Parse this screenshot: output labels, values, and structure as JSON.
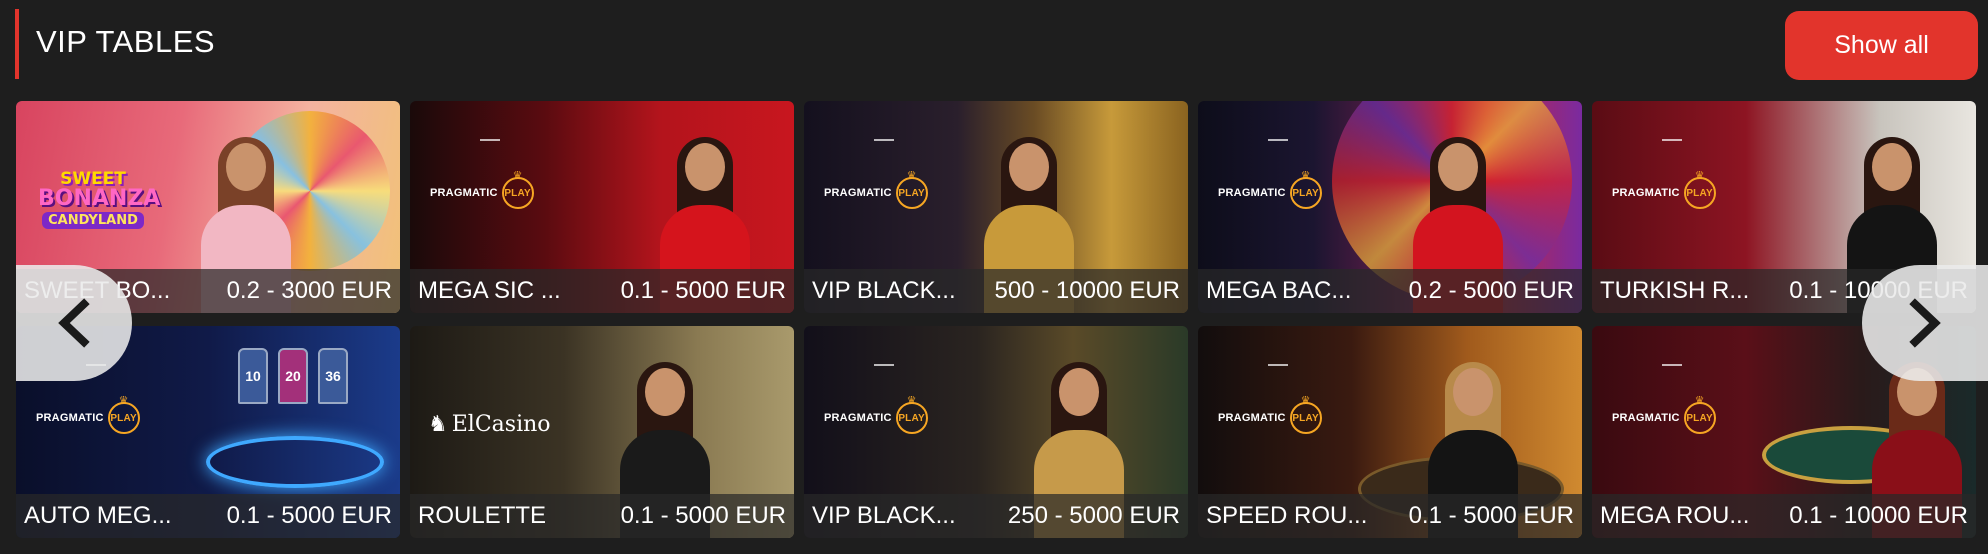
{
  "header": {
    "title": "VIP TABLES",
    "show_all_label": "Show all"
  },
  "brands": {
    "pragmatic_text": "PRAGMATIC",
    "pragmatic_badge": "PLAY",
    "elcasino_text": "ElCasino",
    "sweet_line1": "SWEET",
    "sweet_line2": "BONANZA",
    "sweet_line3": "CANDYLAND"
  },
  "tiles": [
    {
      "name": "SWEET BO...",
      "limits": "0.2 - 3000 EUR"
    },
    {
      "name": "MEGA SIC ...",
      "limits": "0.1 - 5000 EUR"
    },
    {
      "name": "VIP BLACK...",
      "limits": "500 - 10000 EUR"
    },
    {
      "name": "MEGA BAC...",
      "limits": "0.2 - 5000 EUR"
    },
    {
      "name": "TURKISH R...",
      "limits": "0.1 - 10000 EUR"
    },
    {
      "name": "AUTO MEG...",
      "limits": "0.1 - 5000 EUR"
    },
    {
      "name": "ROULETTE",
      "limits": "0.1 - 5000 EUR"
    },
    {
      "name": "VIP BLACK...",
      "limits": "250 - 5000 EUR"
    },
    {
      "name": "SPEED ROU...",
      "limits": "0.1 - 5000 EUR"
    },
    {
      "name": "MEGA ROU...",
      "limits": "0.1 - 10000 EUR"
    }
  ],
  "auto_mega_multipliers": [
    "10",
    "20",
    "36"
  ],
  "colors": {
    "accent": "#e2342c",
    "background": "#1e1e1e",
    "caption_text": "#ffffff"
  },
  "icons": {
    "prev": "chevron-left-icon",
    "next": "chevron-right-icon"
  }
}
